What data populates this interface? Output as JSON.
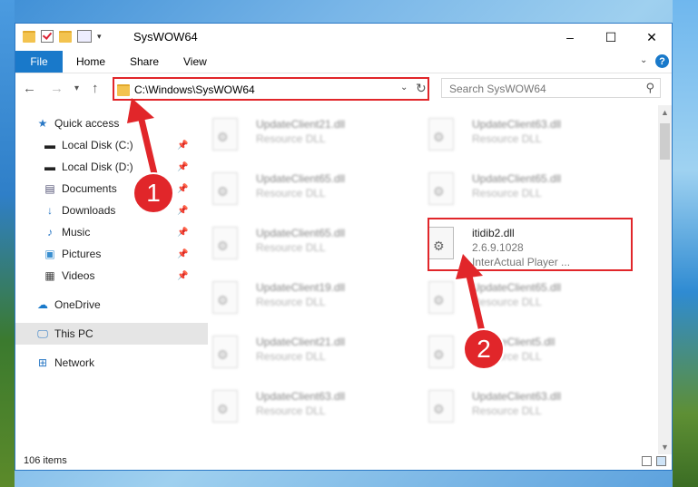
{
  "window": {
    "title": "SysWOW64",
    "minimize": "–",
    "maximize": "☐",
    "close": "✕"
  },
  "ribbon": {
    "file": "File",
    "home": "Home",
    "share": "Share",
    "view": "View",
    "help": "?"
  },
  "nav": {
    "back": "←",
    "forward": "→",
    "recent": "▾",
    "up": "↑",
    "address": "C:\\Windows\\SysWOW64",
    "refresh": "↻",
    "search_placeholder": "Search SysWOW64"
  },
  "sidebar": {
    "items": [
      {
        "label": "Quick access",
        "icon": "star-icon"
      },
      {
        "label": "Local Disk (C:)",
        "icon": "drive-icon"
      },
      {
        "label": "Local Disk (D:)",
        "icon": "drive-icon"
      },
      {
        "label": "Documents",
        "icon": "documents-icon"
      },
      {
        "label": "Downloads",
        "icon": "downloads-icon"
      },
      {
        "label": "Music",
        "icon": "music-icon"
      },
      {
        "label": "Pictures",
        "icon": "pictures-icon"
      },
      {
        "label": "Videos",
        "icon": "videos-icon"
      },
      {
        "label": "OneDrive",
        "icon": "cloud-icon"
      },
      {
        "label": "This PC",
        "icon": "computer-icon"
      },
      {
        "label": "Network",
        "icon": "network-icon"
      }
    ]
  },
  "files": [
    {
      "name": "UpdateClient21.dll",
      "type": "Resource DLL"
    },
    {
      "name": "UpdateClient63.dll",
      "type": "Resource DLL"
    },
    {
      "name": "UpdateClient65.dll",
      "type": "Resource DLL"
    },
    {
      "name": "UpdateClient65.dll",
      "type": "Resource DLL"
    },
    {
      "name": "UpdateClient65.dll",
      "type": "Resource DLL"
    },
    {
      "name": "UpdateClient19.dll",
      "type": "Resource DLL"
    },
    {
      "name": "UpdateClient65.dll",
      "type": "Resource DLL"
    },
    {
      "name": "UpdateClient21.dll",
      "type": "Resource DLL"
    },
    {
      "name": "UpdateClient5.dll",
      "type": "Resource DLL"
    },
    {
      "name": "UpdateClient63.dll",
      "type": "Resource DLL"
    },
    {
      "name": "UpdateClient63.dll",
      "type": "Resource DLL"
    }
  ],
  "highlighted_file": {
    "name": "itidib2.dll",
    "version": "2.6.9.1028",
    "company": "InterActual Player ..."
  },
  "annotations": {
    "step1": "1",
    "step2": "2"
  },
  "status": {
    "items": "106 items"
  },
  "colors": {
    "accent": "#1979ca",
    "highlight": "#e1262a"
  }
}
